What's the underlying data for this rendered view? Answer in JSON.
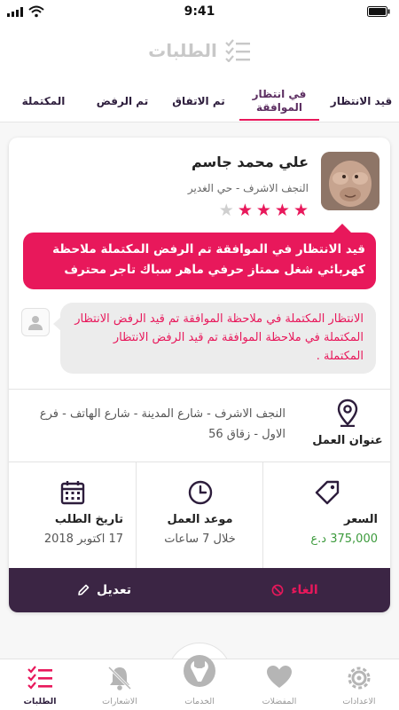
{
  "status_bar": {
    "time": "9:41"
  },
  "header": {
    "title": "الطلبات",
    "icon": "list-check-icon"
  },
  "tabs": [
    {
      "label": "قيد الانتظار",
      "active": false
    },
    {
      "label": "في انتظار الموافقة",
      "active": true
    },
    {
      "label": "تم الاتفاق",
      "active": false
    },
    {
      "label": "تم الرفض",
      "active": false
    },
    {
      "label": "المكتملة",
      "active": false
    }
  ],
  "order": {
    "user_name": "علي محمد جاسم",
    "location": "النجف الاشرف - حي الغدير",
    "rating": 4,
    "rating_max": 5,
    "request_message": "قيد الانتظار في الموافقة تم الرفض المكتملة ملاحظة كهربائي شغل ممتاز حرفي ماهر سباك تاجر محترف",
    "reply_message": "الانتظار المكتملة في ملاحظة الموافقة تم قيد الرفض الانتظار المكتملة في ملاحظة الموافقة تم قيد الرفض الانتظار المكتملة .",
    "address_label": "عنوان العمل",
    "address": "النجف الاشرف - شارع المدينة - شارع الهاتف - فرع الاول - زقاق 56",
    "price_label": "السعر",
    "price_value": "375,000 د.ع",
    "work_time_label": "موعد العمل",
    "work_time_value": "خلال 7 ساعات",
    "date_label": "تاريخ الطلب",
    "date_value": "17 اكتوبر 2018",
    "cancel_label": "الغاء",
    "edit_label": "تعديل"
  },
  "bottom_nav": [
    {
      "label": "الاعدادات",
      "icon": "gear-icon",
      "active": false
    },
    {
      "label": "المفضلات",
      "icon": "heart-icon",
      "active": false
    },
    {
      "label": "الخدمات",
      "icon": "wrench-icon",
      "active": false
    },
    {
      "label": "الاشعارات",
      "icon": "bell-icon",
      "active": false
    },
    {
      "label": "الطلبات",
      "icon": "list-check-icon",
      "active": true
    }
  ],
  "colors": {
    "accent": "#e8185b",
    "dark": "#3b2544",
    "price": "#3c9a3c"
  }
}
